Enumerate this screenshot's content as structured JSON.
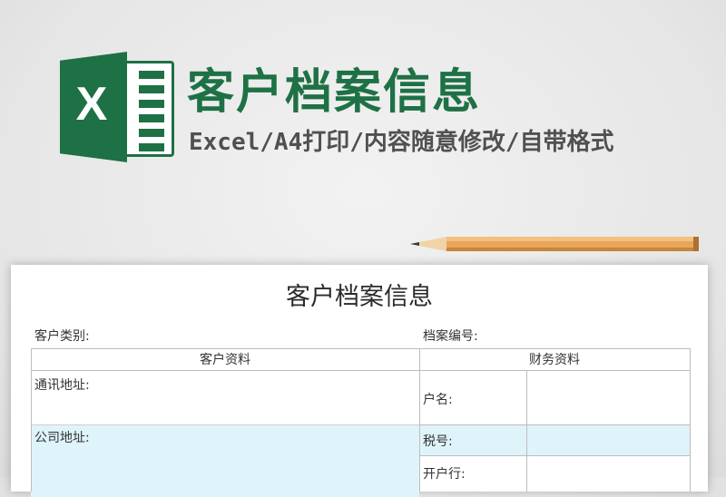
{
  "banner": {
    "title": "客户档案信息",
    "subtitle": "Excel/A4打印/内容随意修改/自带格式",
    "logo_letter": "X"
  },
  "colors": {
    "brand_green": "#1e7145",
    "row_highlight": "#dff3fb",
    "pencil_wood": "#e8a65a"
  },
  "form": {
    "title": "客户档案信息",
    "customer_category_label": "客户类别:",
    "archive_number_label": "档案编号:",
    "left_section": "客户资料",
    "right_section": "财务资料",
    "left_fields": [
      "通讯地址:",
      "公司地址:"
    ],
    "right_fields": [
      "户名:",
      "税号:",
      "开户行:"
    ]
  }
}
